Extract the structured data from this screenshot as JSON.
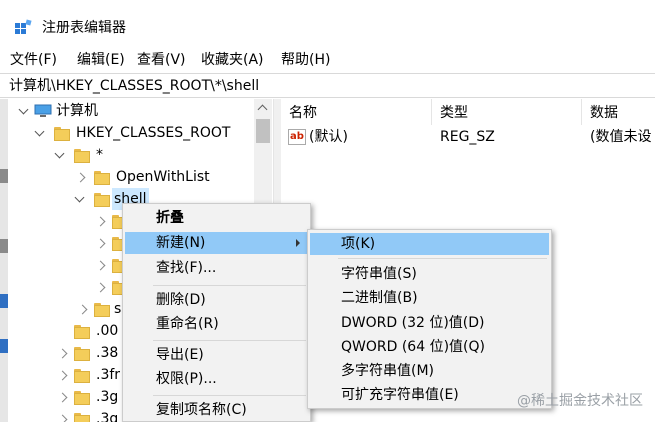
{
  "window": {
    "title": "注册表编辑器",
    "icon": "regedit-icon"
  },
  "menubar": [
    {
      "label": "文件(F)"
    },
    {
      "label": "编辑(E)"
    },
    {
      "label": "查看(V)"
    },
    {
      "label": "收藏夹(A)"
    },
    {
      "label": "帮助(H)"
    }
  ],
  "address": {
    "path": "计算机\\HKEY_CLASSES_ROOT\\*\\shell"
  },
  "tree": {
    "computer": "计算机",
    "root_key": "HKEY_CLASSES_ROOT",
    "star_key": "*",
    "openwithlist": "OpenWithList",
    "shell": "shell",
    "partial_s": "s",
    "ext_00": ".00",
    "ext_38": ".38",
    "ext_3fr": ".3fr",
    "ext_3g": ".3g",
    "ext_3g2": ".3g"
  },
  "columns": {
    "name": "名称",
    "type": "类型",
    "data": "数据"
  },
  "values": [
    {
      "name": "(默认)",
      "type": "REG_SZ",
      "data": "(数值未设"
    }
  ],
  "context_menu": {
    "items": [
      {
        "label": "折叠",
        "bold": true
      },
      {
        "label": "新建(N)",
        "highlight": true,
        "submenu": true
      },
      {
        "label": "查找(F)..."
      },
      {
        "label": "删除(D)"
      },
      {
        "label": "重命名(R)"
      },
      {
        "label": "导出(E)"
      },
      {
        "label": "权限(P)..."
      },
      {
        "label": "复制项名称(C)"
      }
    ]
  },
  "submenu": {
    "items": [
      {
        "label": "项(K)",
        "highlight": true
      },
      {
        "label": "字符串值(S)"
      },
      {
        "label": "二进制值(B)"
      },
      {
        "label": "DWORD (32 位)值(D)"
      },
      {
        "label": "QWORD (64 位)值(Q)"
      },
      {
        "label": "多字符串值(M)"
      },
      {
        "label": "可扩充字符串值(E)"
      }
    ]
  },
  "watermark": "@稀土掘金技术社区",
  "colors": {
    "highlight": "#91c9f7",
    "selection": "#cce8ff",
    "folder": "#f4cd5a"
  }
}
